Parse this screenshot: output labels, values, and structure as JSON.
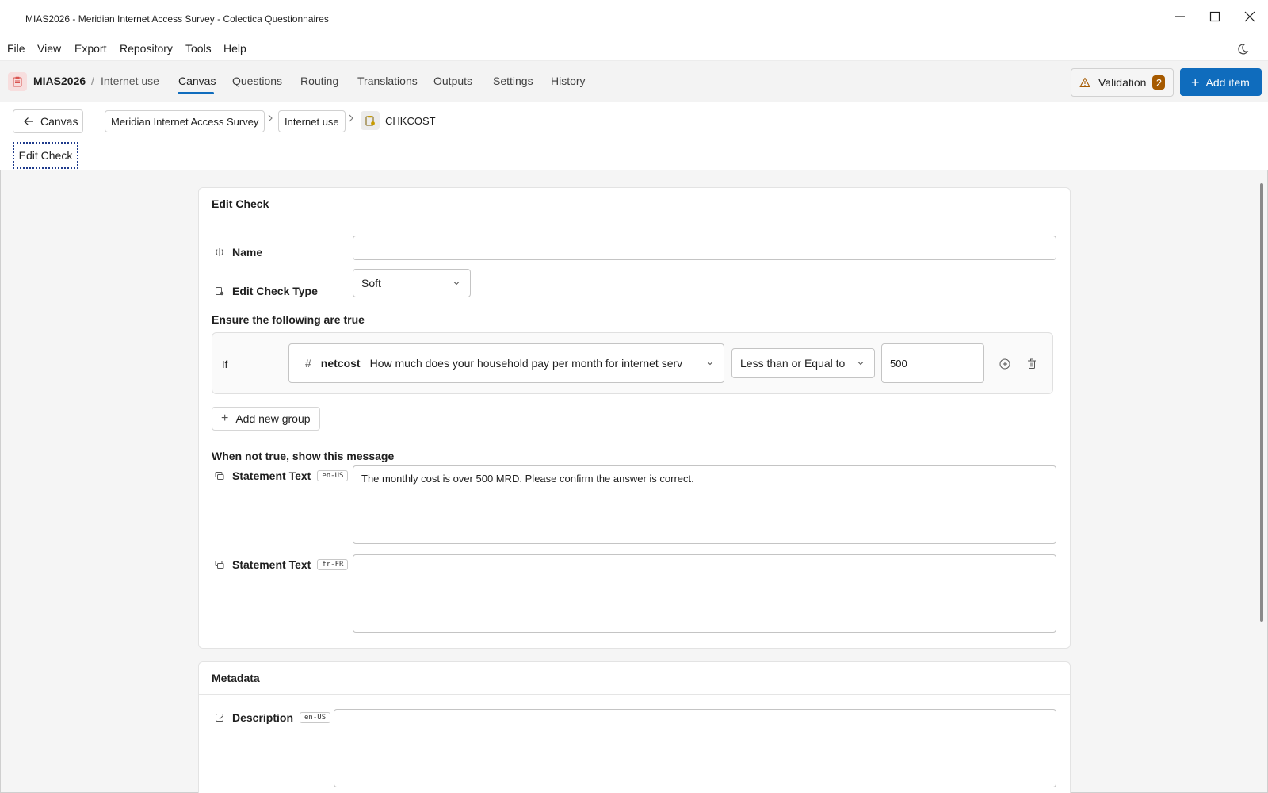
{
  "window": {
    "title": "MIAS2026 - Meridian Internet Access Survey - Colectica Questionnaires"
  },
  "menu": [
    "File",
    "View",
    "Export",
    "Repository",
    "Tools",
    "Help"
  ],
  "nav": {
    "project": "MIAS2026",
    "separator": "/",
    "subtitle": "Internet use",
    "tabs": [
      "Canvas",
      "Questions",
      "Routing",
      "Translations",
      "Outputs",
      "Settings",
      "History"
    ],
    "active_tab": "Canvas",
    "validation_label": "Validation",
    "validation_count": "2",
    "add_item_label": "Add item"
  },
  "breadcrumb": {
    "back_label": "Canvas",
    "items": [
      "Meridian Internet Access Survey",
      "Internet use"
    ],
    "current": "CHKCOST"
  },
  "tab_row": {
    "tab": "Edit Check"
  },
  "edit_check": {
    "header": "Edit Check",
    "name_label": "Name",
    "name_value": "",
    "type_label": "Edit Check Type",
    "type_value": "Soft",
    "conditions_title": "Ensure the following are true",
    "if_label": "If",
    "variable_name": "netcost",
    "variable_question": "How much does your household pay per month for internet serv",
    "operator": "Less than or Equal to",
    "compare_value": "500",
    "add_group_label": "Add new group",
    "message_title": "When not true, show this message",
    "statement_label": "Statement Text",
    "statements": [
      {
        "lang": "en-US",
        "text": "The monthly cost is over 500 MRD. Please confirm the answer is correct."
      },
      {
        "lang": "fr-FR",
        "text": ""
      }
    ]
  },
  "metadata": {
    "header": "Metadata",
    "description_label": "Description",
    "description_lang": "en-US",
    "description_value": ""
  },
  "colors": {
    "accent": "#0f6cbd",
    "badge": "#a65a00",
    "project_icon_bg": "#f7dede"
  }
}
